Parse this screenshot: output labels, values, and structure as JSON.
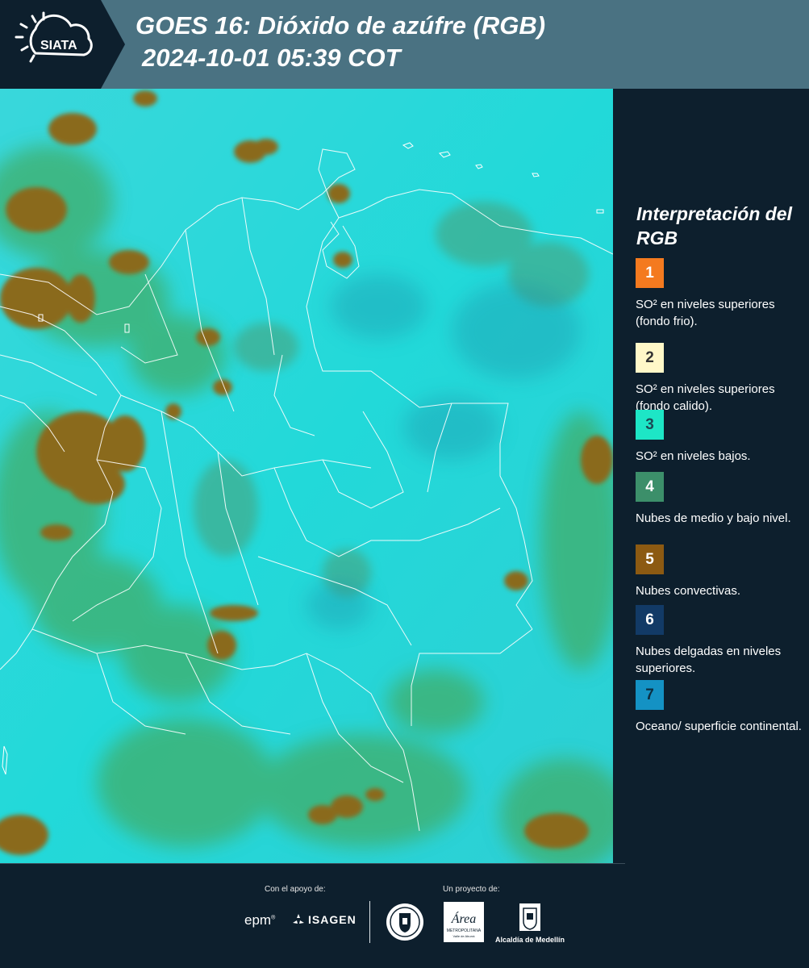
{
  "header": {
    "logo_text": "SIATA",
    "title_line1": "GOES 16: Dióxido de azúfre (RGB)",
    "title_line2": "2024-10-01 05:39 COT"
  },
  "colors": {
    "header_bg": "#4a7282",
    "panel_bg": "#0d1f2d",
    "ocean_cyan": "#25d6d8",
    "convective_brown": "#8a6a1e",
    "low_cloud_green": "#3fa86a"
  },
  "legend": {
    "title": "Interpretación del RGB",
    "items": [
      {
        "number": "1",
        "color": "#f47a1f",
        "text_color": "#ffffff",
        "text": "SO² en niveles superiores (fondo frio)."
      },
      {
        "number": "2",
        "color": "#fff8c8",
        "text_color": "#333333",
        "text": "SO² en niveles superiores (fondo calido)."
      },
      {
        "number": "3",
        "color": "#1de6c6",
        "text_color": "#1b4b55",
        "text": "SO² en niveles bajos."
      },
      {
        "number": "4",
        "color": "#3c8f6a",
        "text_color": "#ffffff",
        "text": "Nubes de medio y bajo nivel."
      },
      {
        "number": "5",
        "color": "#8c5a12",
        "text_color": "#ffffff",
        "text": "Nubes convectivas."
      },
      {
        "number": "6",
        "color": "#123a66",
        "text_color": "#ffffff",
        "text": "Nubes delgadas en niveles superiores."
      },
      {
        "number": "7",
        "color": "#1492c4",
        "text_color": "#0d2e40",
        "text": "Oceano/ superficie continental."
      }
    ]
  },
  "footer": {
    "support_caption": "Con el apoyo de:",
    "project_caption": "Un proyecto de:",
    "epm_label": "epm",
    "isagen_label": "ISAGEN",
    "area_label": "Área",
    "area_sub": "METROPOLITANA",
    "area_sub2": "Valle de Aburrá",
    "alcaldia_label": "Alcaldía de Medellín"
  }
}
